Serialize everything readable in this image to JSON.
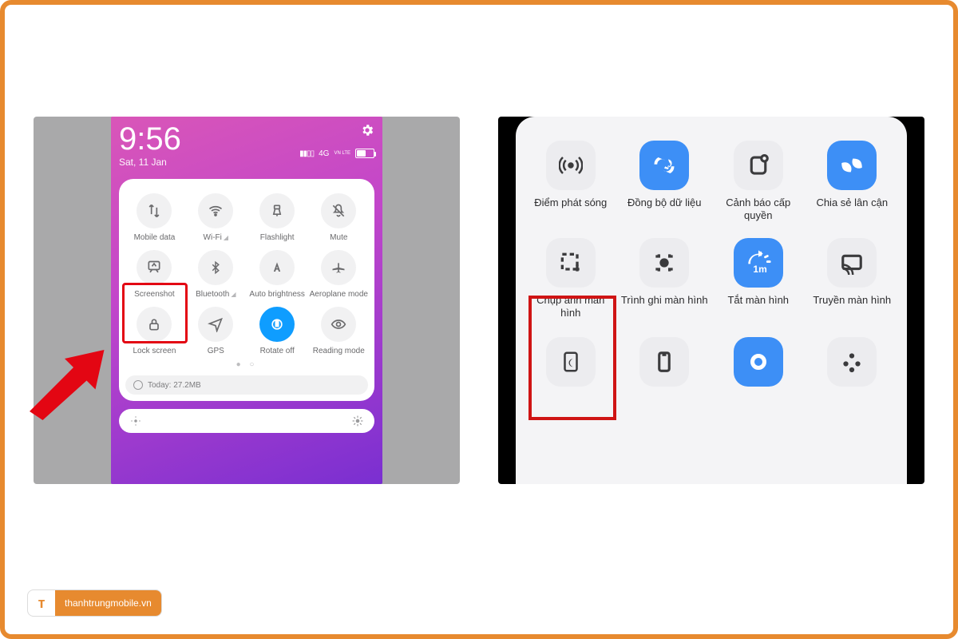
{
  "left": {
    "time": "9:56",
    "date": "Sat, 11 Jan",
    "network_label": "4G",
    "network_sub": "VN LTE",
    "battery_text": "54",
    "tiles": [
      {
        "label": "Mobile data",
        "icon": "data",
        "sub": ""
      },
      {
        "label": "Wi-Fi",
        "icon": "wifi",
        "sub": "◢"
      },
      {
        "label": "Flashlight",
        "icon": "flash",
        "sub": ""
      },
      {
        "label": "Mute",
        "icon": "mute",
        "sub": ""
      },
      {
        "label": "Screenshot",
        "icon": "screenshot",
        "sub": ""
      },
      {
        "label": "Bluetooth",
        "icon": "bt",
        "sub": "◢"
      },
      {
        "label": "Auto brightness",
        "icon": "autobright",
        "sub": ""
      },
      {
        "label": "Aeroplane mode",
        "icon": "plane",
        "sub": ""
      },
      {
        "label": "Lock screen",
        "icon": "lock",
        "sub": ""
      },
      {
        "label": "GPS",
        "icon": "gps",
        "sub": ""
      },
      {
        "label": "Rotate off",
        "icon": "rotate",
        "sub": "",
        "active": true
      },
      {
        "label": "Reading mode",
        "icon": "read",
        "sub": ""
      }
    ],
    "today_label": "Today: 27.2MB"
  },
  "right": {
    "tiles": [
      {
        "label": "Điểm phát sóng",
        "icon": "hotspot",
        "active": false
      },
      {
        "label": "Đồng bộ dữ liệu",
        "icon": "sync",
        "active": true
      },
      {
        "label": "Cảnh báo cấp quyền",
        "icon": "alert",
        "active": false
      },
      {
        "label": "Chia sẻ lân cận",
        "icon": "nearby",
        "active": true
      },
      {
        "label": "Chụp ảnh màn hình",
        "icon": "screenshot2",
        "active": false
      },
      {
        "label": "Trình ghi màn hình",
        "icon": "record",
        "active": false
      },
      {
        "label": "Tắt màn hình",
        "icon": "timer",
        "active": true,
        "badge": "1m"
      },
      {
        "label": "Truyền màn hình",
        "icon": "cast",
        "active": false
      }
    ],
    "row3_icons": [
      "moon",
      "phone",
      "circle",
      "more"
    ]
  },
  "watermark": "thanhtrungmobile.vn"
}
